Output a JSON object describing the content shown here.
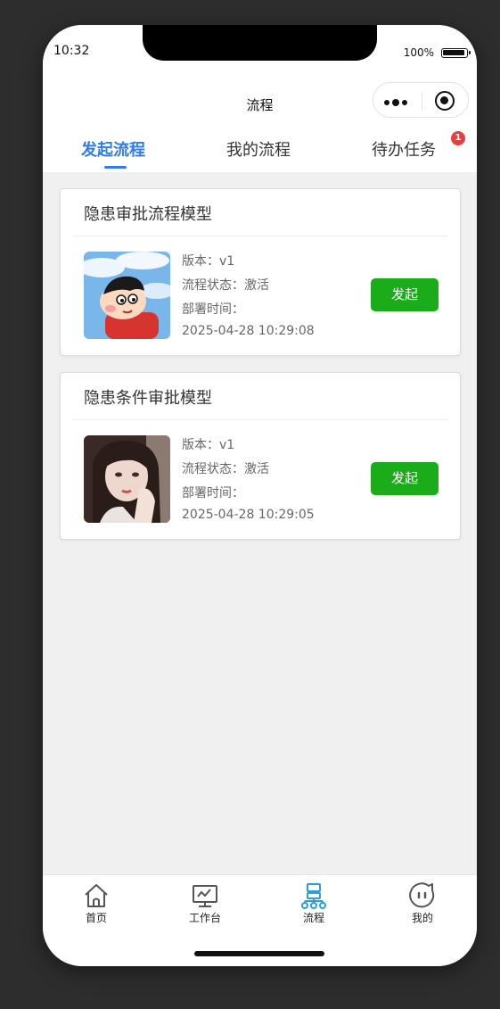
{
  "status_bar": {
    "time": "10:32",
    "battery_percent": "100%"
  },
  "nav": {
    "title": "流程"
  },
  "tabs": [
    {
      "label": "发起流程",
      "active": true
    },
    {
      "label": "我的流程",
      "active": false
    },
    {
      "label": "待办任务",
      "active": false,
      "badge": "1"
    }
  ],
  "processes": [
    {
      "title": "隐患审批流程模型",
      "version": "版本：v1",
      "status": "流程状态：激活",
      "deploy_label": "部署时间：",
      "deploy_time": "2025-04-28 10:29:08",
      "launch_label": "发起"
    },
    {
      "title": "隐患条件审批模型",
      "version": "版本：v1",
      "status": "流程状态：激活",
      "deploy_label": "部署时间：",
      "deploy_time": "2025-04-28 10:29:05",
      "launch_label": "发起"
    }
  ],
  "tabbar": [
    {
      "label": "首页",
      "icon": "home-icon"
    },
    {
      "label": "工作台",
      "icon": "monitor-icon"
    },
    {
      "label": "流程",
      "icon": "flow-icon",
      "active": true
    },
    {
      "label": "我的",
      "icon": "face-icon"
    }
  ],
  "colors": {
    "accent": "#2f7cf0",
    "launch_button": "#1aad19",
    "badge": "#ee3b3b",
    "active_tabbar": "#2a9ee0"
  }
}
